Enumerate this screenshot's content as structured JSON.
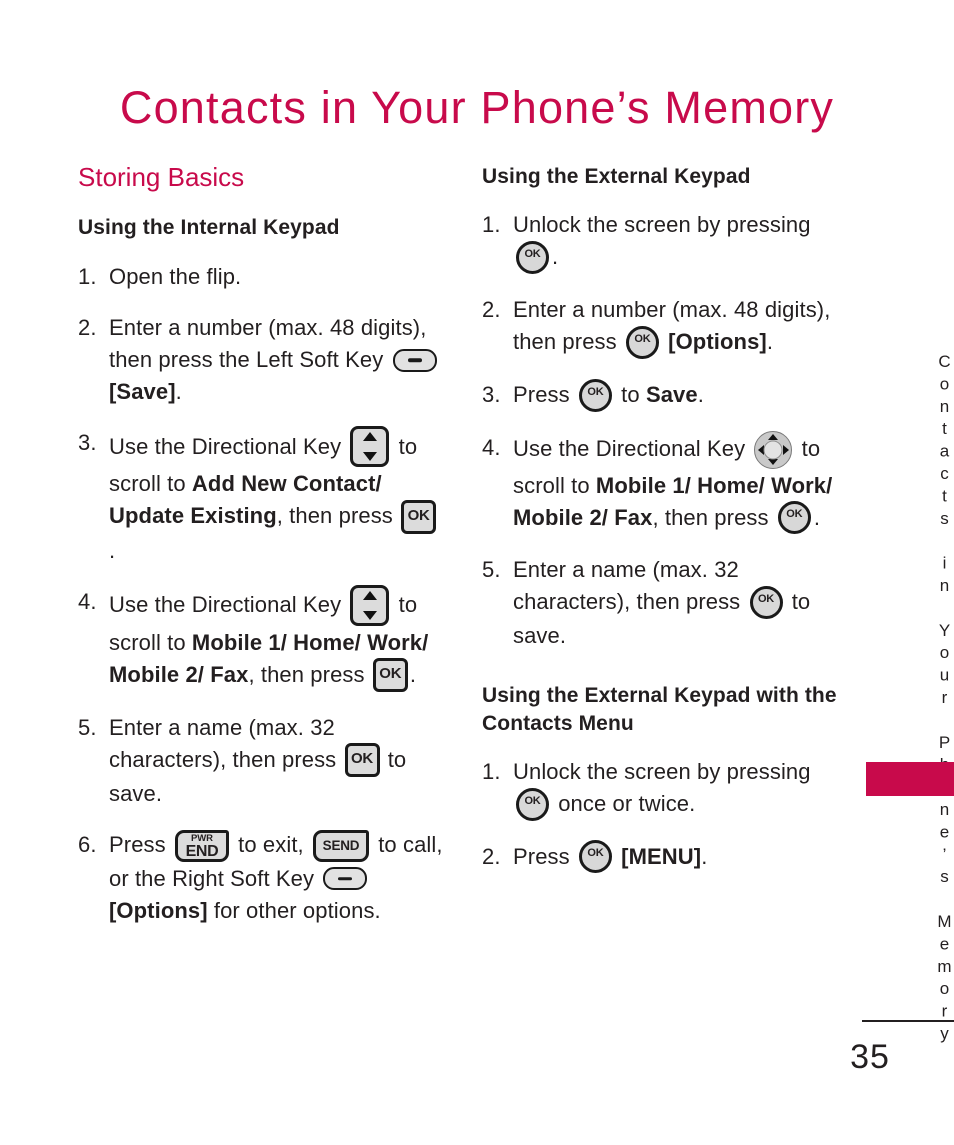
{
  "colors": {
    "accent": "#C80A4B",
    "text": "#231f20",
    "key_fill": "#dcdcdc",
    "key_border": "#1a1a1a"
  },
  "page_title": "Contacts in Your Phone’s Memory",
  "side_tab": {
    "text": "Contacts in Your Phone’s Memory"
  },
  "footer": {
    "page_number": "35"
  },
  "icons": {
    "soft_key": "soft-key-icon",
    "ok_key": "OK",
    "ok_circle_key": "OK",
    "dir_key_updown": "directional-key-updown-icon",
    "dir_key_4way": "directional-key-4way-icon",
    "pwr_label": "PWR",
    "end_label": "END",
    "send_label": "SEND"
  },
  "left_column": {
    "section_title": "Storing Basics",
    "subsection_title": "Using the Internal Keypad",
    "steps": [
      {
        "num": "1.",
        "parts": [
          {
            "t": "text",
            "v": "Open the flip."
          }
        ]
      },
      {
        "num": "2.",
        "parts": [
          {
            "t": "text",
            "v": "Enter a number (max. 48 digits), then press the Left Soft Key "
          },
          {
            "t": "icon",
            "v": "soft"
          },
          {
            "t": "text",
            "v": " "
          },
          {
            "t": "bold",
            "v": "[Save]"
          },
          {
            "t": "text",
            "v": "."
          }
        ]
      },
      {
        "num": "3.",
        "parts": [
          {
            "t": "text",
            "v": "Use the Directional Key "
          },
          {
            "t": "icon",
            "v": "dir"
          },
          {
            "t": "text",
            "v": " to scroll to "
          },
          {
            "t": "bold",
            "v": "Add New Contact/ Update Existing"
          },
          {
            "t": "text",
            "v": ", then press "
          },
          {
            "t": "icon",
            "v": "ok"
          },
          {
            "t": "text",
            "v": "."
          }
        ]
      },
      {
        "num": "4.",
        "parts": [
          {
            "t": "text",
            "v": "Use the Directional Key "
          },
          {
            "t": "icon",
            "v": "dir"
          },
          {
            "t": "text",
            "v": " to scroll to "
          },
          {
            "t": "bold",
            "v": "Mobile 1/ Home/ Work/ Mobile 2/ Fax"
          },
          {
            "t": "text",
            "v": ", then press "
          },
          {
            "t": "icon",
            "v": "ok"
          },
          {
            "t": "text",
            "v": "."
          }
        ]
      },
      {
        "num": "5.",
        "parts": [
          {
            "t": "text",
            "v": "Enter a name (max. 32 characters), then press "
          },
          {
            "t": "icon",
            "v": "ok"
          },
          {
            "t": "text",
            "v": " to save."
          }
        ]
      },
      {
        "num": "6.",
        "parts": [
          {
            "t": "text",
            "v": "Press "
          },
          {
            "t": "icon",
            "v": "end"
          },
          {
            "t": "text",
            "v": " to exit, "
          },
          {
            "t": "icon",
            "v": "send"
          },
          {
            "t": "text",
            "v": " to call, or the Right Soft Key "
          },
          {
            "t": "icon",
            "v": "soft"
          },
          {
            "t": "text",
            "v": " "
          },
          {
            "t": "bold",
            "v": "[Options]"
          },
          {
            "t": "text",
            "v": " for other options."
          }
        ]
      }
    ]
  },
  "right_column": {
    "subsection_title": "Using the External Keypad",
    "steps": [
      {
        "num": "1.",
        "parts": [
          {
            "t": "text",
            "v": "Unlock the screen by pressing "
          },
          {
            "t": "icon",
            "v": "okc"
          },
          {
            "t": "text",
            "v": "."
          }
        ]
      },
      {
        "num": "2.",
        "parts": [
          {
            "t": "text",
            "v": "Enter a number (max. 48 digits), then press "
          },
          {
            "t": "icon",
            "v": "okc"
          },
          {
            "t": "text",
            "v": " "
          },
          {
            "t": "bold",
            "v": "[Options]"
          },
          {
            "t": "text",
            "v": "."
          }
        ]
      },
      {
        "num": "3.",
        "parts": [
          {
            "t": "text",
            "v": "Press "
          },
          {
            "t": "icon",
            "v": "okc"
          },
          {
            "t": "text",
            "v": " to "
          },
          {
            "t": "bold",
            "v": "Save"
          },
          {
            "t": "text",
            "v": "."
          }
        ]
      },
      {
        "num": "4.",
        "parts": [
          {
            "t": "text",
            "v": "Use the Directional Key "
          },
          {
            "t": "icon",
            "v": "dirc"
          },
          {
            "t": "text",
            "v": " to scroll to "
          },
          {
            "t": "bold",
            "v": "Mobile 1/ Home/ Work/ Mobile 2/ Fax"
          },
          {
            "t": "text",
            "v": ", then press "
          },
          {
            "t": "icon",
            "v": "okc"
          },
          {
            "t": "text",
            "v": "."
          }
        ]
      },
      {
        "num": "5.",
        "parts": [
          {
            "t": "text",
            "v": "Enter a name (max. 32 characters), then press "
          },
          {
            "t": "icon",
            "v": "okc"
          },
          {
            "t": "text",
            "v": " to save."
          }
        ]
      }
    ],
    "subsection_title_2": "Using the External Keypad with the Contacts Menu",
    "steps_2": [
      {
        "num": "1.",
        "parts": [
          {
            "t": "text",
            "v": "Unlock the screen by pressing "
          },
          {
            "t": "icon",
            "v": "okc"
          },
          {
            "t": "text",
            "v": " once or twice."
          }
        ]
      },
      {
        "num": "2.",
        "parts": [
          {
            "t": "text",
            "v": "Press "
          },
          {
            "t": "icon",
            "v": "okc"
          },
          {
            "t": "text",
            "v": " "
          },
          {
            "t": "bold",
            "v": "[MENU]"
          },
          {
            "t": "text",
            "v": "."
          }
        ]
      }
    ]
  }
}
